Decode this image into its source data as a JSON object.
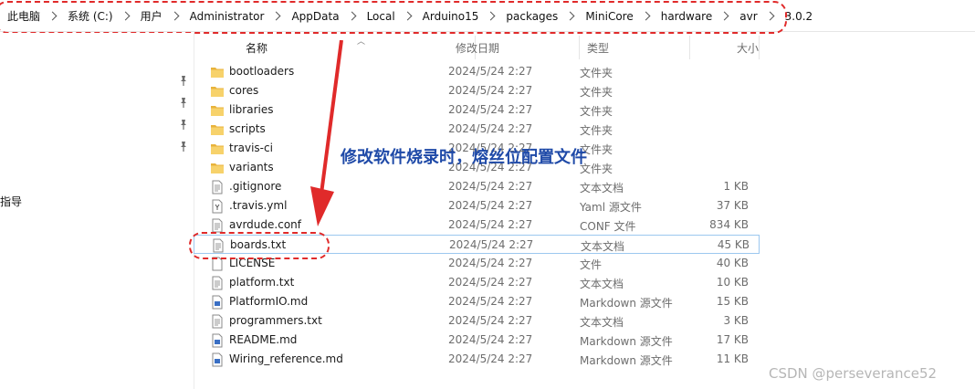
{
  "breadcrumb": [
    "此电脑",
    "系统 (C:)",
    "用户",
    "Administrator",
    "AppData",
    "Local",
    "Arduino15",
    "packages",
    "MiniCore",
    "hardware",
    "avr",
    "3.0.2"
  ],
  "nav": {
    "partial_label": "指导"
  },
  "columns": {
    "name": "名称",
    "date": "修改日期",
    "type": "类型",
    "size": "大小"
  },
  "files": [
    {
      "name": "bootloaders",
      "date": "2024/5/24 2:27",
      "type": "文件夹",
      "size": "",
      "icon": "folder-icon"
    },
    {
      "name": "cores",
      "date": "2024/5/24 2:27",
      "type": "文件夹",
      "size": "",
      "icon": "folder-icon"
    },
    {
      "name": "libraries",
      "date": "2024/5/24 2:27",
      "type": "文件夹",
      "size": "",
      "icon": "folder-icon"
    },
    {
      "name": "scripts",
      "date": "2024/5/24 2:27",
      "type": "文件夹",
      "size": "",
      "icon": "folder-icon"
    },
    {
      "name": "travis-ci",
      "date": "2024/5/24 2:27",
      "type": "文件夹",
      "size": "",
      "icon": "folder-icon"
    },
    {
      "name": "variants",
      "date": "2024/5/24 2:27",
      "type": "文件夹",
      "size": "",
      "icon": "folder-icon"
    },
    {
      "name": ".gitignore",
      "date": "2024/5/24 2:27",
      "type": "文本文档",
      "size": "1 KB",
      "icon": "text-file-icon"
    },
    {
      "name": ".travis.yml",
      "date": "2024/5/24 2:27",
      "type": "Yaml 源文件",
      "size": "37 KB",
      "icon": "yaml-file-icon"
    },
    {
      "name": "avrdude.conf",
      "date": "2024/5/24 2:27",
      "type": "CONF 文件",
      "size": "834 KB",
      "icon": "conf-file-icon"
    },
    {
      "name": "boards.txt",
      "date": "2024/5/24 2:27",
      "type": "文本文档",
      "size": "45 KB",
      "icon": "text-file-icon",
      "highlighted": true
    },
    {
      "name": "LICENSE",
      "date": "2024/5/24 2:27",
      "type": "文件",
      "size": "40 KB",
      "icon": "blank-file-icon"
    },
    {
      "name": "platform.txt",
      "date": "2024/5/24 2:27",
      "type": "文本文档",
      "size": "10 KB",
      "icon": "text-file-icon"
    },
    {
      "name": "PlatformIO.md",
      "date": "2024/5/24 2:27",
      "type": "Markdown 源文件",
      "size": "15 KB",
      "icon": "markdown-file-icon"
    },
    {
      "name": "programmers.txt",
      "date": "2024/5/24 2:27",
      "type": "文本文档",
      "size": "3 KB",
      "icon": "text-file-icon"
    },
    {
      "name": "README.md",
      "date": "2024/5/24 2:27",
      "type": "Markdown 源文件",
      "size": "17 KB",
      "icon": "markdown-file-icon"
    },
    {
      "name": "Wiring_reference.md",
      "date": "2024/5/24 2:27",
      "type": "Markdown 源文件",
      "size": "11 KB",
      "icon": "markdown-file-icon"
    }
  ],
  "annotation": {
    "text": "修改软件烧录时，熔丝位配置文件",
    "color": "#1f4aa8",
    "marker_color": "#e02a2a"
  },
  "watermark": "CSDN @perseverance52"
}
